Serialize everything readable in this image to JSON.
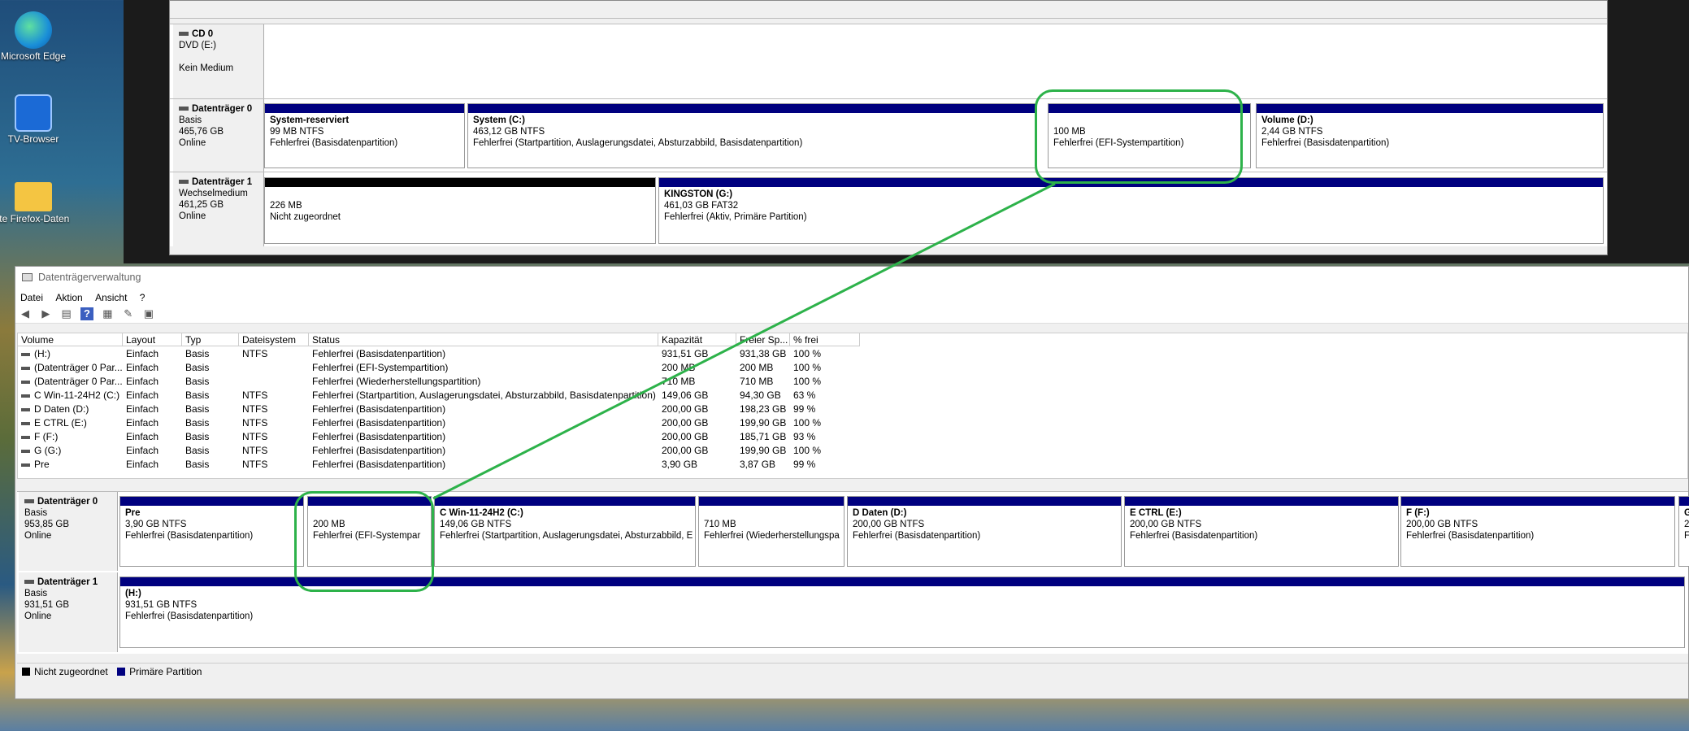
{
  "desktop_icons": [
    {
      "label": "Microsoft Edge",
      "icon": "edge-icon"
    },
    {
      "label": "TV-Browser",
      "icon": "tv-browser-icon"
    },
    {
      "label": "lte Firefox-Daten",
      "icon": "folder-icon"
    }
  ],
  "top_window": {
    "cd": {
      "name": "CD 0",
      "type": "DVD (E:)",
      "status": "Kein Medium"
    },
    "disk0": {
      "name": "Datenträger 0",
      "type": "Basis",
      "size": "465,76 GB",
      "status": "Online",
      "partitions": [
        {
          "name": "System-reserviert",
          "size": "99 MB NTFS",
          "status": "Fehlerfrei (Basisdatenpartition)"
        },
        {
          "name": "System  (C:)",
          "size": "463,12 GB NTFS",
          "status": "Fehlerfrei (Startpartition, Auslagerungsdatei, Absturzabbild, Basisdatenpartition)"
        },
        {
          "name": "",
          "size": "100 MB",
          "status": "Fehlerfrei (EFI-Systempartition)"
        },
        {
          "name": "Volume  (D:)",
          "size": "2,44 GB NTFS",
          "status": "Fehlerfrei (Basisdatenpartition)"
        }
      ]
    },
    "disk1": {
      "name": "Datenträger 1",
      "type": "Wechselmedium",
      "size": "461,25 GB",
      "status": "Online",
      "partitions": [
        {
          "name": "",
          "size": "226 MB",
          "status": "Nicht zugeordnet"
        },
        {
          "name": "KINGSTON  (G:)",
          "size": "461,03 GB FAT32",
          "status": "Fehlerfrei (Aktiv, Primäre Partition)"
        }
      ]
    }
  },
  "main_window": {
    "title": "Datenträgerverwaltung",
    "menu": [
      "Datei",
      "Aktion",
      "Ansicht",
      "?"
    ],
    "columns": [
      "Volume",
      "Layout",
      "Typ",
      "Dateisystem",
      "Status",
      "Kapazität",
      "Freier Sp...",
      "% frei"
    ],
    "rows": [
      [
        "(H:)",
        "Einfach",
        "Basis",
        "NTFS",
        "Fehlerfrei (Basisdatenpartition)",
        "931,51 GB",
        "931,38 GB",
        "100 %"
      ],
      [
        "(Datenträger 0 Par...",
        "Einfach",
        "Basis",
        "",
        "Fehlerfrei (EFI-Systempartition)",
        "200 MB",
        "200 MB",
        "100 %"
      ],
      [
        "(Datenträger 0 Par...",
        "Einfach",
        "Basis",
        "",
        "Fehlerfrei (Wiederherstellungspartition)",
        "710 MB",
        "710 MB",
        "100 %"
      ],
      [
        "C Win-11-24H2 (C:)",
        "Einfach",
        "Basis",
        "NTFS",
        "Fehlerfrei (Startpartition, Auslagerungsdatei, Absturzabbild, Basisdatenpartition)",
        "149,06 GB",
        "94,30 GB",
        "63 %"
      ],
      [
        "D Daten (D:)",
        "Einfach",
        "Basis",
        "NTFS",
        "Fehlerfrei (Basisdatenpartition)",
        "200,00 GB",
        "198,23 GB",
        "99 %"
      ],
      [
        "E CTRL (E:)",
        "Einfach",
        "Basis",
        "NTFS",
        "Fehlerfrei (Basisdatenpartition)",
        "200,00 GB",
        "199,90 GB",
        "100 %"
      ],
      [
        "F (F:)",
        "Einfach",
        "Basis",
        "NTFS",
        "Fehlerfrei (Basisdatenpartition)",
        "200,00 GB",
        "185,71 GB",
        "93 %"
      ],
      [
        "G (G:)",
        "Einfach",
        "Basis",
        "NTFS",
        "Fehlerfrei (Basisdatenpartition)",
        "200,00 GB",
        "199,90 GB",
        "100 %"
      ],
      [
        "Pre",
        "Einfach",
        "Basis",
        "NTFS",
        "Fehlerfrei (Basisdatenpartition)",
        "3,90 GB",
        "3,87 GB",
        "99 %"
      ]
    ],
    "disk0": {
      "name": "Datenträger 0",
      "type": "Basis",
      "size": "953,85 GB",
      "status": "Online",
      "partitions": [
        {
          "name": "Pre",
          "size": "3,90 GB NTFS",
          "status": "Fehlerfrei (Basisdatenpartition)"
        },
        {
          "name": "",
          "size": "200 MB",
          "status": "Fehlerfrei (EFI-Systempar"
        },
        {
          "name": "C Win-11-24H2  (C:)",
          "size": "149,06 GB NTFS",
          "status": "Fehlerfrei (Startpartition, Auslagerungsdatei, Absturzabbild, E"
        },
        {
          "name": "",
          "size": "710 MB",
          "status": "Fehlerfrei (Wiederherstellungspa"
        },
        {
          "name": "D Daten  (D:)",
          "size": "200,00 GB NTFS",
          "status": "Fehlerfrei (Basisdatenpartition)"
        },
        {
          "name": "E CTRL  (E:)",
          "size": "200,00 GB NTFS",
          "status": "Fehlerfrei (Basisdatenpartition)"
        },
        {
          "name": "F  (F:)",
          "size": "200,00 GB NTFS",
          "status": "Fehlerfrei (Basisdatenpartition)"
        },
        {
          "name": "G",
          "size": "2",
          "status": "F"
        }
      ]
    },
    "disk1": {
      "name": "Datenträger 1",
      "type": "Basis",
      "size": "931,51 GB",
      "status": "Online",
      "partitions": [
        {
          "name": "(H:)",
          "size": "931,51 GB NTFS",
          "status": "Fehlerfrei (Basisdatenpartition)"
        }
      ]
    },
    "legend": [
      "Nicht zugeordnet",
      "Primäre Partition"
    ]
  },
  "colors": {
    "primary_partition": "#00007f",
    "unallocated": "#000000",
    "highlight": "#2db24a"
  }
}
